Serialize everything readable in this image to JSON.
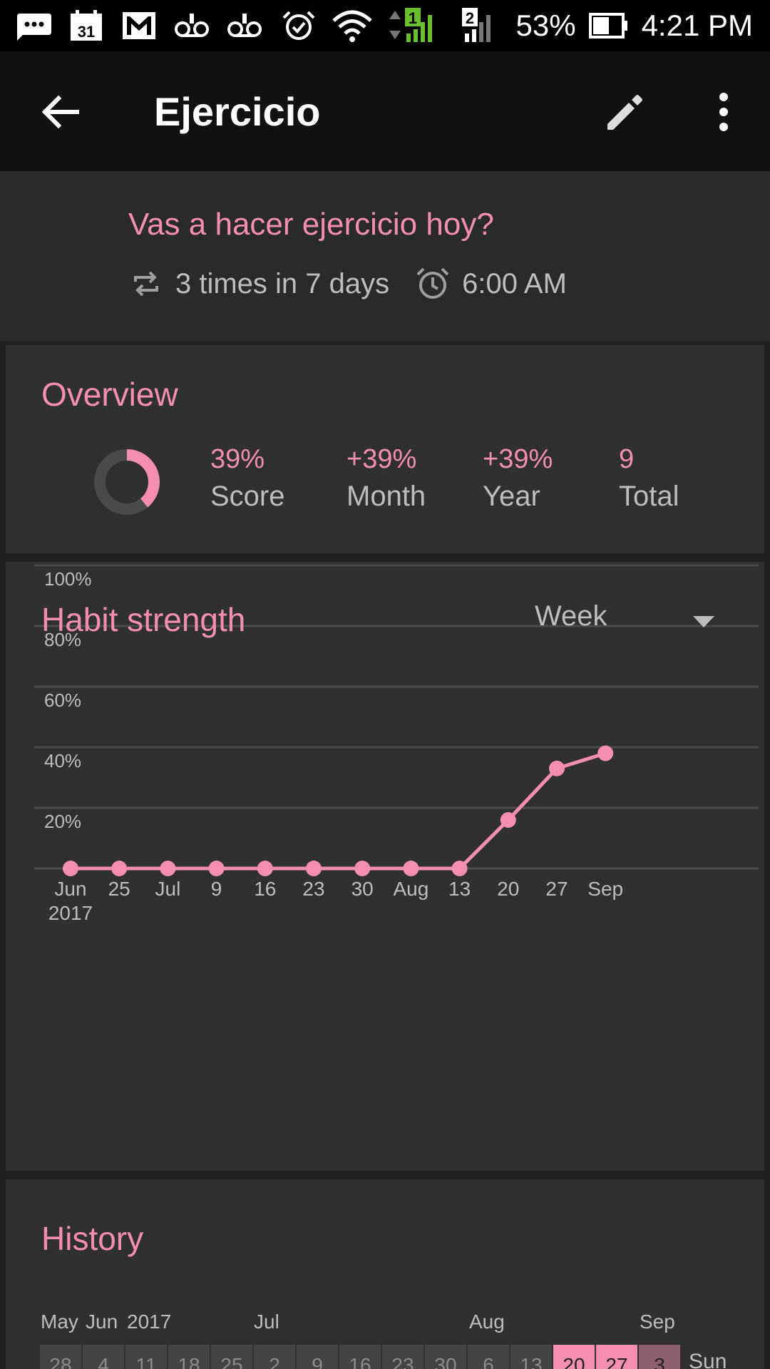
{
  "status_bar": {
    "left_icons": [
      "message-icon",
      "calendar-icon",
      "gmail-icon",
      "voicemail-icon",
      "voicemail-icon"
    ],
    "calendar_day": "31",
    "battery": "53%",
    "time": "4:21 PM",
    "sim1": "1",
    "sim2": "2"
  },
  "app_bar": {
    "title": "Ejercicio"
  },
  "header": {
    "question": "Vas a hacer ejercicio hoy?",
    "frequency": "3 times in 7 days",
    "reminder": "6:00 AM"
  },
  "overview": {
    "title": "Overview",
    "score_fraction": 0.39,
    "stats": [
      {
        "value": "39%",
        "label": "Score"
      },
      {
        "value": "+39%",
        "label": "Month"
      },
      {
        "value": "+39%",
        "label": "Year"
      },
      {
        "value": "9",
        "label": "Total"
      }
    ]
  },
  "strength": {
    "title": "Habit strength",
    "period": "Week"
  },
  "chart_data": {
    "type": "line",
    "title": "Habit strength",
    "x": [
      "Jun",
      "25",
      "Jul",
      "9",
      "16",
      "23",
      "30",
      "Aug",
      "13",
      "20",
      "27",
      "Sep"
    ],
    "x_sublabel_first": "2017",
    "series": [
      {
        "values": [
          0,
          0,
          0,
          0,
          0,
          0,
          0,
          0,
          0,
          16,
          33,
          38
        ]
      }
    ],
    "y_ticks": [
      "20%",
      "40%",
      "60%",
      "80%",
      "100%"
    ],
    "ylim": [
      0,
      100
    ],
    "grid": true,
    "color": "#f48fb1"
  },
  "history": {
    "title": "History",
    "months": [
      "May",
      "Jun",
      "2017",
      "Jul",
      "Aug",
      "Sep"
    ],
    "cells": [
      {
        "day": "28",
        "state": "off"
      },
      {
        "day": "4",
        "state": "off"
      },
      {
        "day": "11",
        "state": "off"
      },
      {
        "day": "18",
        "state": "off"
      },
      {
        "day": "25",
        "state": "off"
      },
      {
        "day": "2",
        "state": "off"
      },
      {
        "day": "9",
        "state": "off"
      },
      {
        "day": "16",
        "state": "off"
      },
      {
        "day": "23",
        "state": "off"
      },
      {
        "day": "30",
        "state": "off"
      },
      {
        "day": "6",
        "state": "off"
      },
      {
        "day": "13",
        "state": "off"
      },
      {
        "day": "20",
        "state": "on"
      },
      {
        "day": "27",
        "state": "on"
      },
      {
        "day": "3",
        "state": "today"
      }
    ],
    "weekday": "Sun"
  },
  "colors": {
    "accent": "#f48fb1",
    "background": "#212121",
    "card": "#303030"
  }
}
